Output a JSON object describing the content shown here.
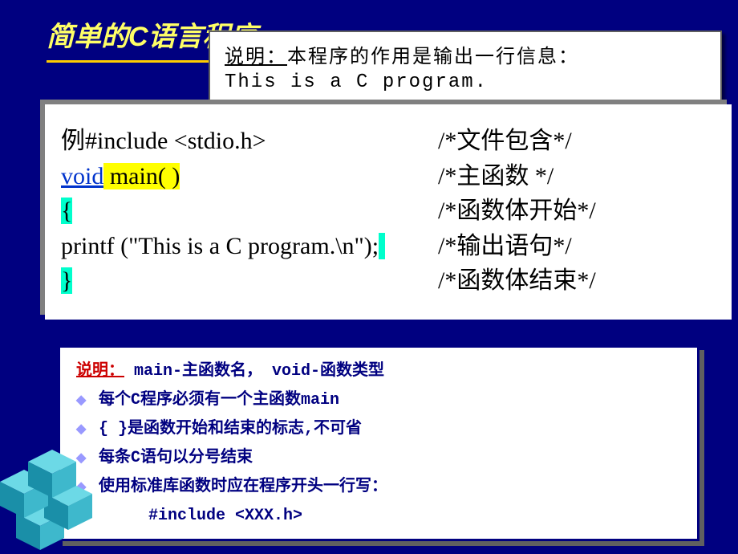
{
  "title": "简单的C语言程序",
  "explain": {
    "label": "说明：",
    "text1": "本程序的作用是输出一行信息：",
    "text2": "This is a C program."
  },
  "code": {
    "line1_prefix": "例",
    "line1_rest": "#include <stdio.h>",
    "line2_void": "void",
    "line2_main": " main( )",
    "line3_open": "{",
    "line4": " printf (\"This is a C program.\\n\");",
    "line5_close": "}",
    "comment1": "/*文件包含*/",
    "comment2": "/*主函数  */",
    "comment3": "/*函数体开始*/",
    "comment4": "/*输出语句*/",
    "comment5": "/*函数体结束*/"
  },
  "info": {
    "heading_label": "说明：",
    "heading_rest": " main-主函数名， void-函数类型",
    "b1": "每个C程序必须有一个主函数main",
    "b2": "{ }是函数开始和结束的标志,不可省",
    "b3": "每条C语句以分号结束",
    "b4": "使用标准库函数时应在程序开头一行写：",
    "b4_sub": "#include <XXX.h>"
  }
}
